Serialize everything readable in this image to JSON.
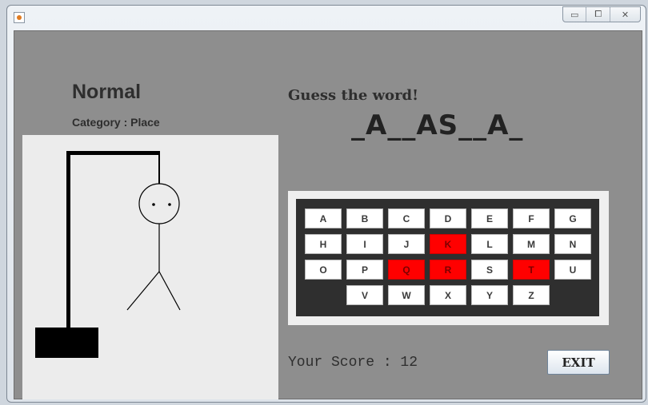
{
  "window": {
    "icon": "java-icon",
    "controls": {
      "minimize": "▭",
      "maximize": "⧠",
      "close": "✕"
    }
  },
  "game": {
    "difficulty": "Normal",
    "category": "Category : Place",
    "prompt": "Guess the word!",
    "word": "_A__AS__A_",
    "score_text": "Your Score : 12",
    "exit_label": "EXIT"
  },
  "keyboard": {
    "rows": [
      [
        "A",
        "B",
        "C",
        "D",
        "E",
        "F",
        "G"
      ],
      [
        "H",
        "I",
        "J",
        "K",
        "L",
        "M",
        "N"
      ],
      [
        "O",
        "P",
        "Q",
        "R",
        "S",
        "T",
        "U"
      ],
      [
        "V",
        "W",
        "X",
        "Y",
        "Z"
      ]
    ],
    "used": [
      "K",
      "Q",
      "R",
      "T"
    ]
  },
  "colors": {
    "panel_bg": "#8e8e8e",
    "used_key": "#ff0000",
    "keyboard_bg": "#2f2f2f"
  }
}
